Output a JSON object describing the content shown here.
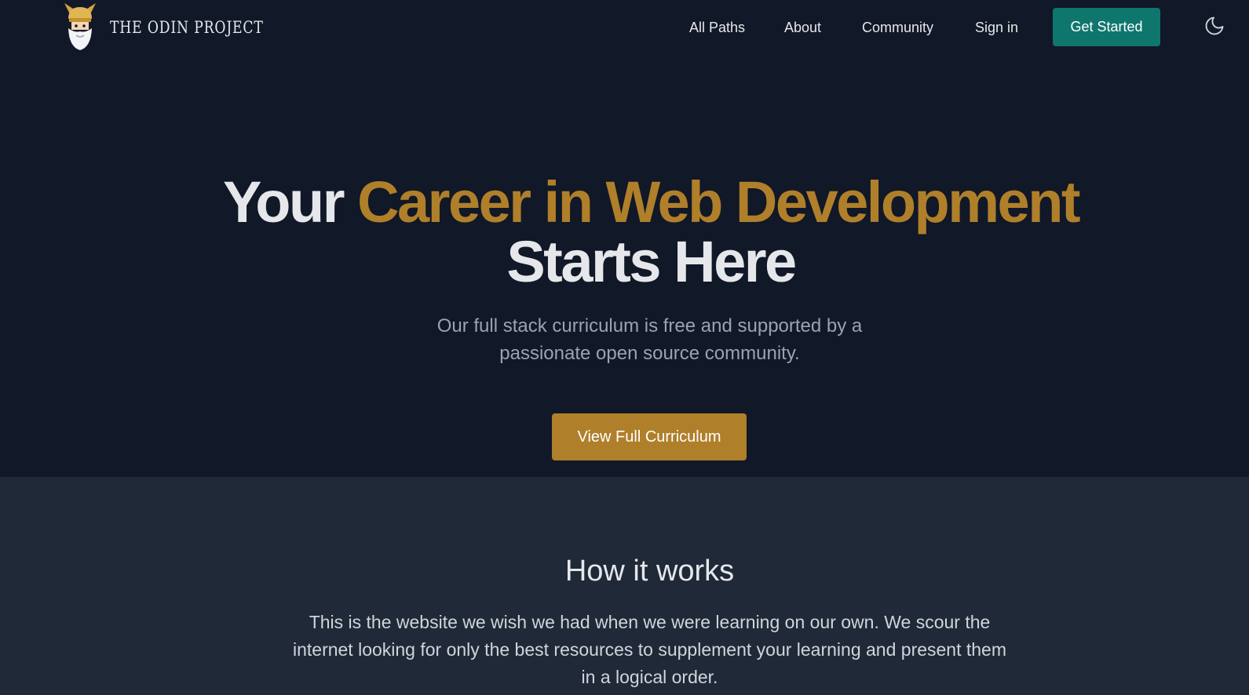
{
  "brand": {
    "name": "THE ODIN PROJECT",
    "logo_icon": "odin-viking-head-icon"
  },
  "nav": {
    "links": [
      "All Paths",
      "About",
      "Community",
      "Sign in"
    ],
    "cta_label": "Get Started",
    "theme_icon": "moon-icon"
  },
  "hero": {
    "title_prefix": "Your",
    "title_highlight": "Career in Web Development",
    "title_suffix": "Starts Here",
    "subtitle_line1": "Our full stack curriculum is free and supported by a",
    "subtitle_line2": "passionate open source community.",
    "cta_label": "View Full Curriculum"
  },
  "how_it_works": {
    "title": "How it works",
    "text_line1": "This is the website we wish we had when we were learning on our own. We scour the",
    "text_line2": "internet looking for only the best resources to supplement your learning and present them",
    "text_line3": "in a logical order."
  },
  "colors": {
    "background": "#111827",
    "section_background": "#1f2937",
    "accent_gold": "#b07f2a",
    "accent_teal": "#0f766e",
    "text": "#e5e7eb",
    "muted_text": "#9ca3af"
  }
}
